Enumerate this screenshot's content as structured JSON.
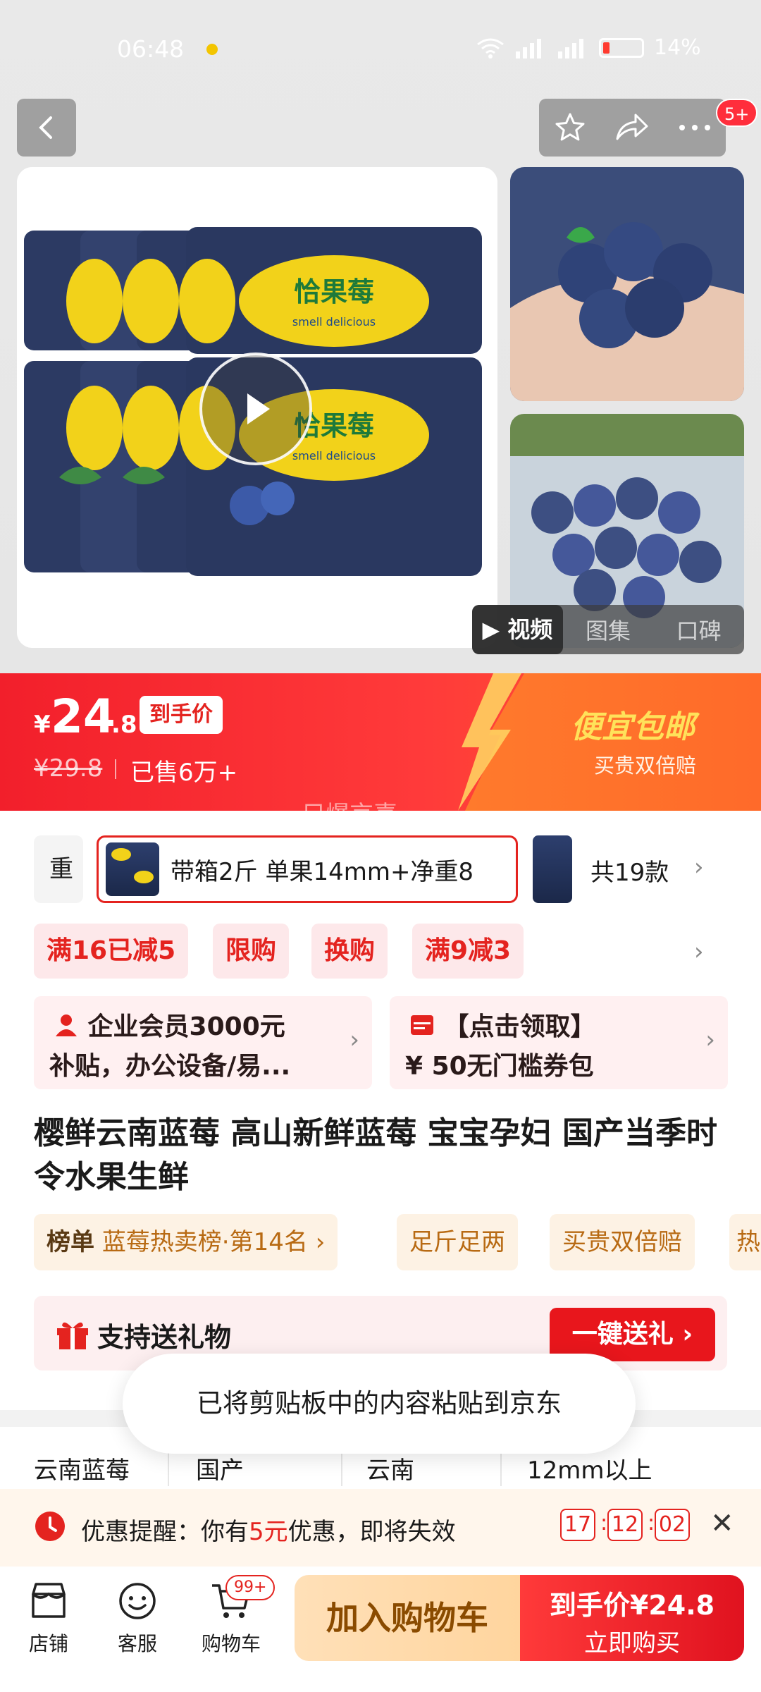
{
  "status_bar": {
    "time": "06:48",
    "battery": "14%",
    "signal1": "5G",
    "signal2": "5G"
  },
  "header": {
    "cart_badge": "5+"
  },
  "gallery": {
    "tabs": [
      "视频",
      "图集",
      "口碑"
    ],
    "active_tab": 0,
    "product_box_text": "恰果莓",
    "product_box_sub": "smell delicious"
  },
  "price": {
    "currency": "¥",
    "main": "24",
    "decimal": ".8",
    "price_label": "到手价",
    "original": "¥29.8",
    "sold": "已售6万+",
    "promo_title": "便宜包邮",
    "promo_sub": "买贵双倍赔",
    "watermark": "只爆京喜"
  },
  "sku": {
    "prev_label": "重",
    "selected_label": "带箱2斤 单果14mm+净重8",
    "count": "共19款"
  },
  "coupons": [
    "满16已减5",
    "限购",
    "换购",
    "满9减3"
  ],
  "cards": [
    {
      "line1": "企业会员3000元",
      "line2": "补贴，办公设备/易...",
      "icon": "person-icon"
    },
    {
      "line1": "【点击领取】",
      "line2": "¥ 50无门槛券包",
      "icon": "coupon-icon"
    }
  ],
  "title": "樱鲜云南蓝莓 高山新鲜蓝莓 宝宝孕妇  国产当季时令水果生鲜",
  "tags": {
    "rank_label": "榜单",
    "rank_text": "蓝莓热卖榜·第14名",
    "tag2": "足斤足两",
    "tag3": "买贵双倍赔",
    "tag4": "热"
  },
  "gift": {
    "text": "支持送礼物",
    "button": "一键送礼"
  },
  "toast": "已将剪贴板中的内容粘贴到京东",
  "specs": [
    "云南蓝莓",
    "国产",
    "云南",
    "12mm以上"
  ],
  "reminder": {
    "label": "优惠提醒：你有",
    "amount": "5元",
    "suffix": "优惠，即将失效",
    "hours": "17",
    "minutes": "12",
    "seconds": "02"
  },
  "bottom_nav": {
    "shop": "店铺",
    "service": "客服",
    "cart": "购物车",
    "cart_badge": "99+",
    "add_cart": "加入购物车",
    "buy_line1": "到手价¥24.8",
    "buy_line2": "立即购买"
  },
  "colors": {
    "brand_red": "#e4231f",
    "promo_orange": "#ff6a2a"
  }
}
